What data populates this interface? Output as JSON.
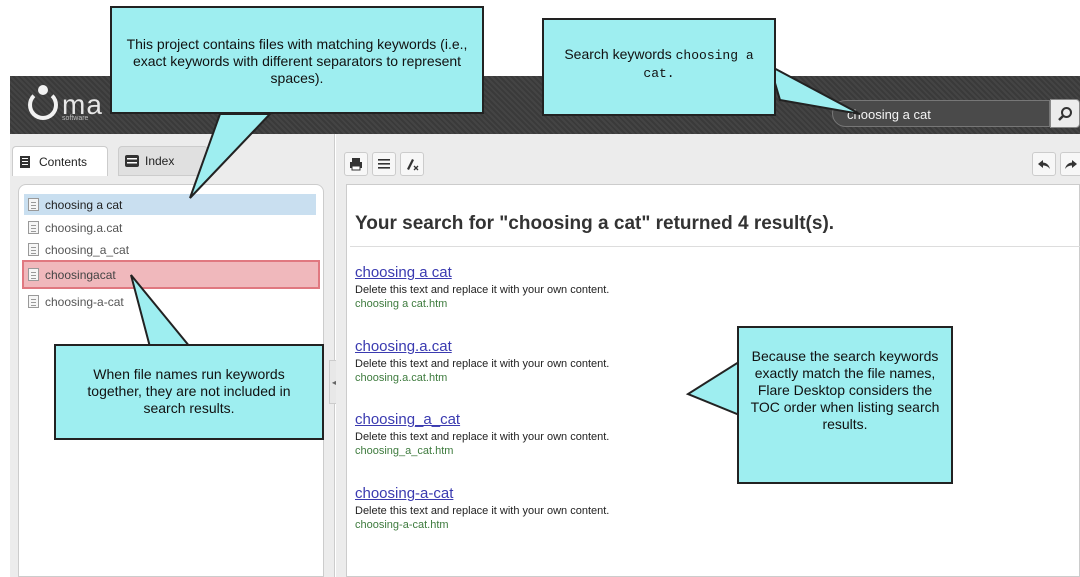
{
  "header": {
    "logo_text": "ma",
    "logo_sub": "software",
    "search_value": "choosing a cat"
  },
  "tabs": [
    {
      "label": "Contents"
    },
    {
      "label": "Index"
    }
  ],
  "toc": [
    {
      "label": "choosing a cat"
    },
    {
      "label": "choosing.a.cat"
    },
    {
      "label": "choosing_a_cat"
    },
    {
      "label": "choosingacat"
    },
    {
      "label": "choosing-a-cat"
    }
  ],
  "results": {
    "heading": "Your search for \"choosing a cat\" returned 4 result(s).",
    "items": [
      {
        "title": "choosing a cat",
        "desc": "Delete this text and replace it with your own content.",
        "file": "choosing a cat.htm"
      },
      {
        "title": "choosing.a.cat",
        "desc": "Delete this text and replace it with your own content.",
        "file": "choosing.a.cat.htm"
      },
      {
        "title": "choosing_a_cat",
        "desc": "Delete this text and replace it with your own content.",
        "file": "choosing_a_cat.htm"
      },
      {
        "title": "choosing-a-cat",
        "desc": "Delete this text and replace it with your own content.",
        "file": "choosing-a-cat.htm"
      }
    ]
  },
  "callouts": {
    "project": "This project contains files with matching keywords (i.e., exact keywords with different separators to represent spaces).",
    "search_prefix": "Search keywords ",
    "search_code": "choosing a cat.",
    "filenames": "When file names run keywords together, they are not included in search results.",
    "toc_order": "Because the search keywords exactly match the file names, Flare Desktop considers the TOC order when listing search results."
  },
  "colors": {
    "callout_bg": "#9eeef0",
    "highlight": "#f0b8bc",
    "selected": "#c9dff0",
    "link": "#3a3ab0",
    "file": "#3e7b3e"
  }
}
